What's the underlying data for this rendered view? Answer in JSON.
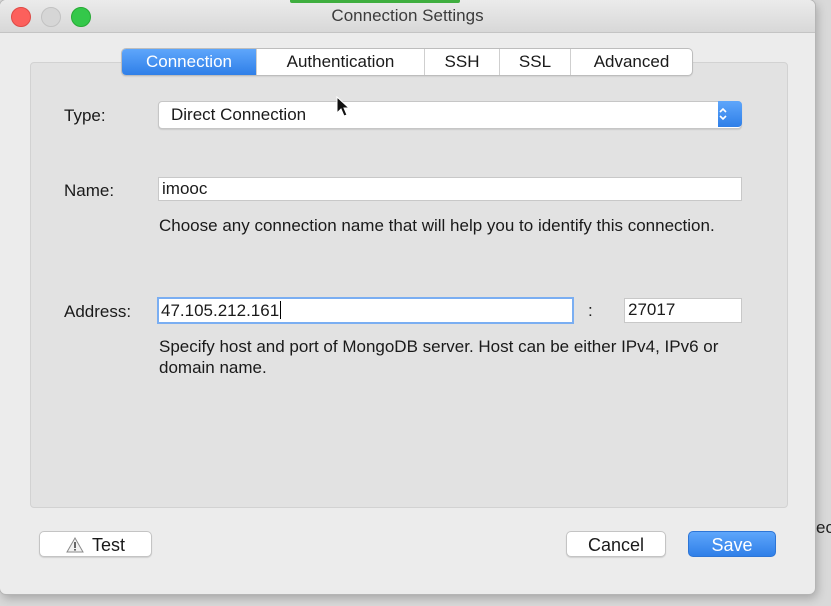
{
  "window": {
    "title": "Connection Settings"
  },
  "tabs": [
    {
      "label": "Connection",
      "active": true
    },
    {
      "label": "Authentication",
      "active": false
    },
    {
      "label": "SSH",
      "active": false
    },
    {
      "label": "SSL",
      "active": false
    },
    {
      "label": "Advanced",
      "active": false
    }
  ],
  "form": {
    "type_label": "Type:",
    "type_value": "Direct Connection",
    "name_label": "Name:",
    "name_value": "imooc",
    "name_help": "Choose any connection name that will help you to identify this connection.",
    "address_label": "Address:",
    "host_value": "47.105.212.161",
    "separator": ":",
    "port_value": "27017",
    "address_help": "Specify host and port of MongoDB server. Host can be either IPv4, IPv6 or domain name."
  },
  "buttons": {
    "test_label": "Test",
    "cancel_label": "Cancel",
    "save_label": "Save"
  },
  "background": {
    "edge_text": "ec"
  },
  "colors": {
    "accent": "#2f7fe8",
    "close": "#fc605c",
    "zoom": "#34c84a"
  },
  "icons": {
    "test": "warning-icon",
    "select": "chevron-updown-icon",
    "pointer": "mouse-pointer-icon"
  }
}
